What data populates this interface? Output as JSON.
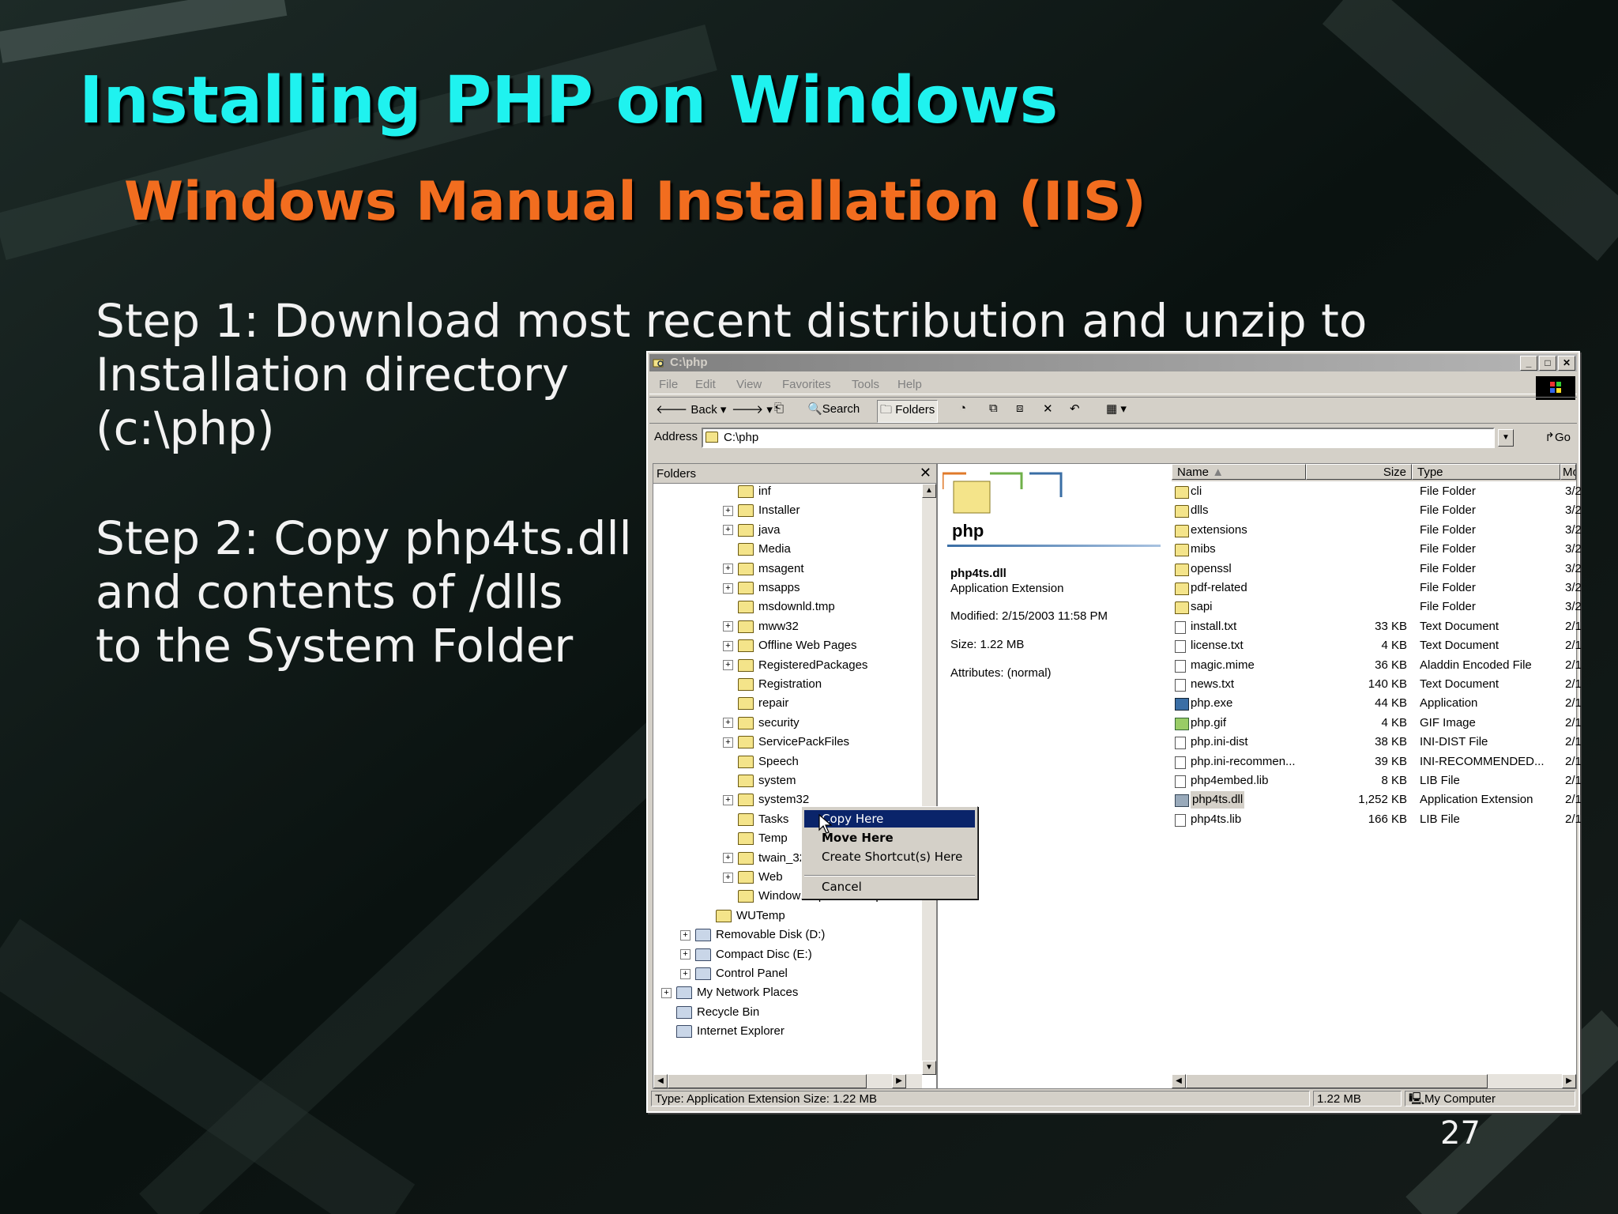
{
  "slide": {
    "title": "Installing PHP on Windows",
    "subtitle": "Windows Manual Installation (IIS)",
    "step1": "Step 1: Download most recent distribution and unzip to\nInstallation directory\n(c:\\php)",
    "step2": "Step 2: Copy php4ts.dll\nand contents of /dlls\nto the System Folder",
    "page_number": "27"
  },
  "window": {
    "title": "C:\\php",
    "menu": [
      "File",
      "Edit",
      "View",
      "Favorites",
      "Tools",
      "Help"
    ],
    "toolbar": {
      "back": "Back",
      "search": "Search",
      "folders": "Folders"
    },
    "address_label": "Address",
    "address_value": "C:\\php",
    "go_label": "Go"
  },
  "folders_pane": {
    "header": "Folders",
    "items": [
      {
        "label": "inf",
        "expandable": false
      },
      {
        "label": "Installer",
        "expandable": true
      },
      {
        "label": "java",
        "expandable": true
      },
      {
        "label": "Media",
        "expandable": false
      },
      {
        "label": "msagent",
        "expandable": true
      },
      {
        "label": "msapps",
        "expandable": true
      },
      {
        "label": "msdownld.tmp",
        "expandable": false
      },
      {
        "label": "mww32",
        "expandable": true
      },
      {
        "label": "Offline Web Pages",
        "expandable": true
      },
      {
        "label": "RegisteredPackages",
        "expandable": true
      },
      {
        "label": "Registration",
        "expandable": false
      },
      {
        "label": "repair",
        "expandable": false
      },
      {
        "label": "security",
        "expandable": true
      },
      {
        "label": "ServicePackFiles",
        "expandable": true
      },
      {
        "label": "Speech",
        "expandable": false
      },
      {
        "label": "system",
        "expandable": false
      },
      {
        "label": "system32",
        "expandable": true
      },
      {
        "label": "Tasks",
        "expandable": false
      },
      {
        "label": "Temp",
        "expandable": false
      },
      {
        "label": "twain_32",
        "expandable": true
      },
      {
        "label": "Web",
        "expandable": true
      },
      {
        "label": "Windows Update Setup Files",
        "expandable": false
      }
    ],
    "root_items": [
      {
        "label": "WUTemp",
        "level": 2,
        "expandable": false
      },
      {
        "label": "Removable Disk (D:)",
        "level": 1,
        "expandable": true
      },
      {
        "label": "Compact Disc (E:)",
        "level": 1,
        "expandable": true
      },
      {
        "label": "Control Panel",
        "level": 1,
        "expandable": true
      },
      {
        "label": "My Network Places",
        "level": 0,
        "expandable": true
      },
      {
        "label": "Recycle Bin",
        "level": 0,
        "expandable": false
      },
      {
        "label": "Internet Explorer",
        "level": 0,
        "expandable": false
      }
    ]
  },
  "context_menu": {
    "items": [
      "Copy Here",
      "Move Here",
      "Create Shortcut(s) Here",
      "Cancel"
    ]
  },
  "preview": {
    "folder_name": "php",
    "file_name": "php4ts.dll",
    "file_type": "Application Extension",
    "modified": "Modified: 2/15/2003 11:58 PM",
    "size": "Size: 1.22 MB",
    "attributes": "Attributes: (normal)"
  },
  "file_list": {
    "columns": [
      "Name",
      "Size",
      "Type",
      "Mod"
    ],
    "rows": [
      {
        "name": "cli",
        "size": "",
        "type": "File Folder",
        "mod": "3/2",
        "kind": "folder"
      },
      {
        "name": "dlls",
        "size": "",
        "type": "File Folder",
        "mod": "3/2",
        "kind": "folder"
      },
      {
        "name": "extensions",
        "size": "",
        "type": "File Folder",
        "mod": "3/2",
        "kind": "folder"
      },
      {
        "name": "mibs",
        "size": "",
        "type": "File Folder",
        "mod": "3/2",
        "kind": "folder"
      },
      {
        "name": "openssl",
        "size": "",
        "type": "File Folder",
        "mod": "3/2",
        "kind": "folder"
      },
      {
        "name": "pdf-related",
        "size": "",
        "type": "File Folder",
        "mod": "3/2",
        "kind": "folder"
      },
      {
        "name": "sapi",
        "size": "",
        "type": "File Folder",
        "mod": "3/2",
        "kind": "folder"
      },
      {
        "name": "install.txt",
        "size": "33 KB",
        "type": "Text Document",
        "mod": "2/1",
        "kind": "doc"
      },
      {
        "name": "license.txt",
        "size": "4 KB",
        "type": "Text Document",
        "mod": "2/1",
        "kind": "doc"
      },
      {
        "name": "magic.mime",
        "size": "36 KB",
        "type": "Aladdin Encoded File",
        "mod": "2/1",
        "kind": "doc"
      },
      {
        "name": "news.txt",
        "size": "140 KB",
        "type": "Text Document",
        "mod": "2/1",
        "kind": "doc"
      },
      {
        "name": "php.exe",
        "size": "44 KB",
        "type": "Application",
        "mod": "2/1",
        "kind": "exe"
      },
      {
        "name": "php.gif",
        "size": "4 KB",
        "type": "GIF Image",
        "mod": "2/1",
        "kind": "img"
      },
      {
        "name": "php.ini-dist",
        "size": "38 KB",
        "type": "INI-DIST File",
        "mod": "2/1",
        "kind": "doc"
      },
      {
        "name": "php.ini-recommen...",
        "size": "39 KB",
        "type": "INI-RECOMMENDED...",
        "mod": "2/1",
        "kind": "doc"
      },
      {
        "name": "php4embed.lib",
        "size": "8 KB",
        "type": "LIB File",
        "mod": "2/1",
        "kind": "doc"
      },
      {
        "name": "php4ts.dll",
        "size": "1,252 KB",
        "type": "Application Extension",
        "mod": "2/1",
        "kind": "dll",
        "selected": true
      },
      {
        "name": "php4ts.lib",
        "size": "166 KB",
        "type": "LIB File",
        "mod": "2/1",
        "kind": "doc"
      }
    ]
  },
  "status": {
    "info": "Type: Application Extension Size: 1.22 MB",
    "size": "1.22 MB",
    "zone": "My Computer"
  },
  "colors": {
    "title": "#1ff2ef",
    "subtitle": "#f26d1f",
    "selection": "#0a246a"
  }
}
